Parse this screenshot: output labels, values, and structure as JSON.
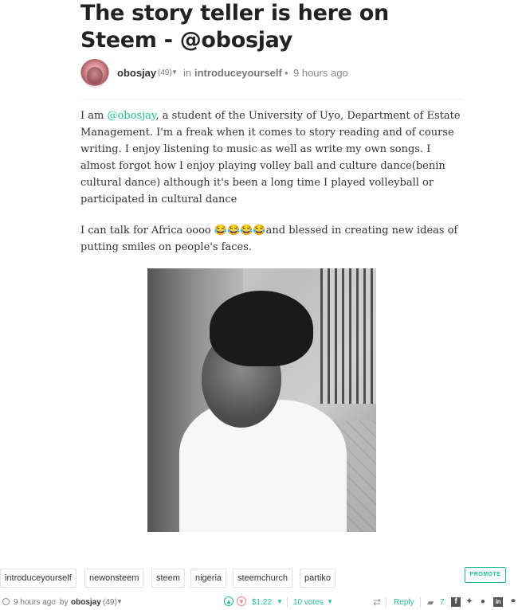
{
  "post": {
    "title": "The story teller is here on Steem - @obosjay",
    "author": "obosjay",
    "reputation": "(49)",
    "in_label": "in",
    "category": "introduceyourself",
    "separator": "•",
    "time": "9 hours ago",
    "paragraph1_pre": "I am ",
    "mention": "@obosjay",
    "paragraph1_post": ", a student of the University of Uyo, Department of Estate Management. I'm a freak when it comes to story reading and of course writing. I enjoy listening to music as well as write my own songs. I almost forgot how I enjoy playing volley ball and culture dance(benin cultural dance) although it's been a long time I played volleyball or participated in cultural dance",
    "paragraph2": "I can talk for Africa oooo 😂😂😂😂and blessed in creating new ideas of putting smiles on people's faces."
  },
  "tags": [
    "introduceyourself",
    "newonsteem",
    "steem",
    "nigeria",
    "steemchurch",
    "partiko"
  ],
  "promote_label": "PROMOTE",
  "footer": {
    "time": "9 hours ago",
    "by_label": "by",
    "author": "obosjay",
    "reputation": "(49)",
    "payout": "$1.22",
    "votes": "10 votes",
    "reply_label": "Reply",
    "comments": "7"
  },
  "icons": {
    "clock": "clock-icon",
    "upvote": "upvote-icon",
    "downvote": "downvote-icon",
    "resteem": "resteem-icon",
    "comment": "comment-icon",
    "facebook": "facebook-icon",
    "twitter": "twitter-icon",
    "reddit": "reddit-icon",
    "linkedin": "linkedin-icon",
    "link": "link-icon"
  },
  "colors": {
    "accent": "#1fbf8f",
    "downvote": "#ee8888",
    "text": "#333333"
  }
}
